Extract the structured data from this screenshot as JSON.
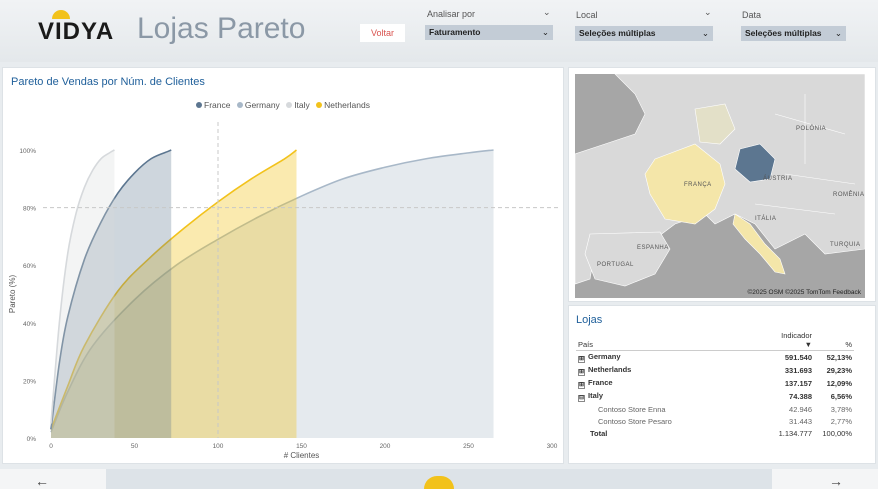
{
  "header": {
    "logo": "VIDYA",
    "title": "Lojas Pareto",
    "back_label": "Voltar"
  },
  "filters": [
    {
      "label": "Analisar por",
      "value": "Faturamento"
    },
    {
      "label": "Local",
      "value": "Seleções múltiplas"
    },
    {
      "label": "Data",
      "value": "Seleções múltiplas"
    }
  ],
  "chart": {
    "title": "Pareto de Vendas por Núm. de Clientes",
    "legend": [
      {
        "name": "France",
        "color": "#5c7690"
      },
      {
        "name": "Germany",
        "color": "#a8b8c8"
      },
      {
        "name": "Italy",
        "color": "#d6d9dc"
      },
      {
        "name": "Netherlands",
        "color": "#f2c21b"
      }
    ],
    "ylabel": "Pareto (%)",
    "xlabel": "# Clientes",
    "ytick_labels": [
      "0%",
      "20%",
      "40%",
      "60%",
      "80%",
      "100%"
    ],
    "xtick_labels": [
      "0",
      "50",
      "100",
      "150",
      "200",
      "250",
      "300"
    ]
  },
  "chart_data": {
    "type": "area",
    "title": "Pareto de Vendas por Núm. de Clientes",
    "xlabel": "# Clientes",
    "ylabel": "Pareto (%)",
    "xlim": [
      0,
      300
    ],
    "ylim": [
      0,
      100
    ],
    "reference_lines": {
      "y": 80,
      "x": 100
    },
    "series": [
      {
        "name": "Italy",
        "color": "#d6d9dc",
        "x": [
          0,
          5,
          10,
          15,
          20,
          25,
          30,
          35,
          38
        ],
        "y": [
          5,
          40,
          64,
          78,
          87,
          93,
          97,
          99,
          100
        ]
      },
      {
        "name": "France",
        "color": "#5c7690",
        "x": [
          0,
          5,
          10,
          20,
          30,
          40,
          50,
          60,
          70,
          72
        ],
        "y": [
          3,
          26,
          42,
          62,
          75,
          85,
          92,
          97,
          99.5,
          100
        ]
      },
      {
        "name": "Netherlands",
        "color": "#f2c21b",
        "x": [
          0,
          10,
          20,
          40,
          60,
          80,
          100,
          120,
          140,
          147
        ],
        "y": [
          3,
          18,
          32,
          51,
          63,
          73,
          82,
          90,
          97,
          100
        ]
      },
      {
        "name": "Germany",
        "color": "#a8b8c8",
        "x": [
          0,
          10,
          25,
          50,
          75,
          100,
          125,
          150,
          175,
          200,
          225,
          250,
          265
        ],
        "y": [
          2,
          16,
          32,
          48,
          60,
          69,
          77,
          84,
          90,
          94,
          97,
          99,
          100
        ]
      }
    ]
  },
  "map": {
    "credit": "©2025 OSM ©2025 TomTom Feedback",
    "labels": [
      "POLÔNIA",
      "FRANÇA",
      "ÁUSTRIA",
      "ROMÊNIA",
      "ITÁLIA",
      "ESPANHA",
      "PORTUGAL",
      "TURQUIA"
    ]
  },
  "table": {
    "title": "Lojas",
    "columns": [
      "País",
      "Indicador",
      "%"
    ],
    "rows": [
      {
        "name": "Germany",
        "value": "591.540",
        "pct": "52,13%",
        "expander": "⊞"
      },
      {
        "name": "Netherlands",
        "value": "331.693",
        "pct": "29,23%",
        "expander": "⊞"
      },
      {
        "name": "France",
        "value": "137.157",
        "pct": "12,09%",
        "expander": "⊞"
      },
      {
        "name": "Italy",
        "value": "74.388",
        "pct": "6,56%",
        "expander": "⊟"
      }
    ],
    "subrows": [
      {
        "name": "Contoso Store Enna",
        "value": "42.946",
        "pct": "3,78%"
      },
      {
        "name": "Contoso Store Pesaro",
        "value": "31.443",
        "pct": "2,77%"
      }
    ],
    "total": {
      "name": "Total",
      "value": "1.134.777",
      "pct": "100,00%"
    }
  },
  "footer": {
    "prev": "←",
    "next": "→"
  }
}
